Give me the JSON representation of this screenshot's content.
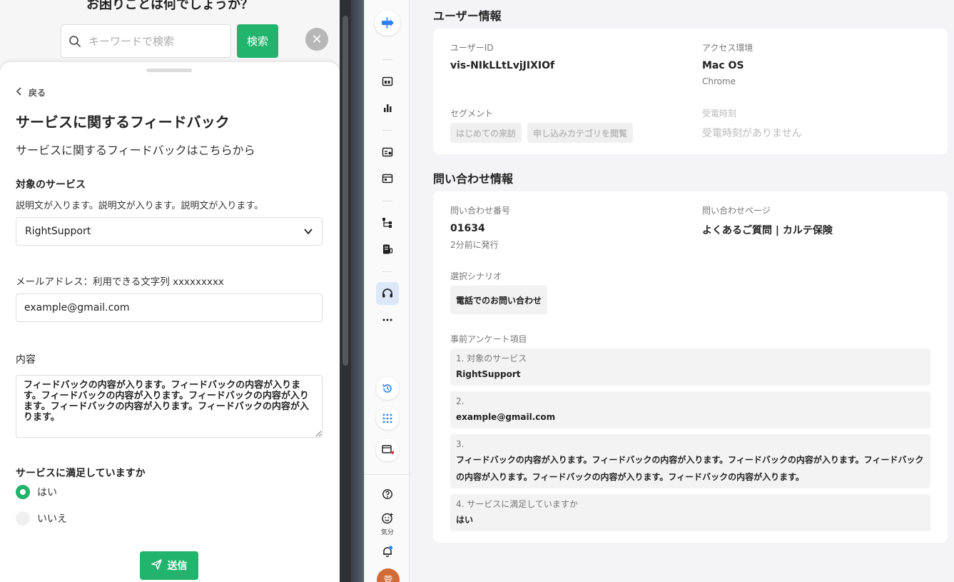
{
  "widget": {
    "help_heading": "お困りごとは何でしょうか？",
    "search": {
      "placeholder": "キーワードで検索",
      "value": "",
      "button_label": "検索"
    },
    "close_label": "✕",
    "back_label": "戻る",
    "title": "サービスに関するフィードバック",
    "subtitle": "サービスに関するフィードバックはこちらから",
    "service_field": {
      "label": "対象のサービス",
      "description": "説明文が入ります。説明文が入ります。説明文が入ります。",
      "selected": "RightSupport"
    },
    "email_field": {
      "label": "メールアドレス：利用できる文字列 xxxxxxxxx",
      "value": "example@gmail.com"
    },
    "content_field": {
      "label": "内容",
      "value": "フィードバックの内容が入ります。フィードバックの内容が入ります。フィードバックの内容が入ります。フィードバックの内容が入ります。フィードバックの内容が入ります。フィードバックの内容が入ります。"
    },
    "satisfaction_field": {
      "label": "サービスに満足していますか",
      "options": [
        "はい",
        "いいえ"
      ],
      "selected": "はい"
    },
    "submit_label": "送信"
  },
  "rail": {
    "mood_label": "気分",
    "avatar_text": "菅",
    "accent_color": "#2f80ed"
  },
  "user_info": {
    "section_title": "ユーザー情報",
    "user_id_label": "ユーザーID",
    "user_id": "vis-NIkLLtLvjJIXIOf",
    "access_label": "アクセス環境",
    "os": "Mac OS",
    "browser": "Chrome",
    "segment_label": "セグメント",
    "segments": [
      "はじめての来訪",
      "申し込みカテゴリを閲覧"
    ],
    "call_time_label": "受電時刻",
    "call_time_value": "受電時刻がありません"
  },
  "inquiry_info": {
    "section_title": "問い合わせ情報",
    "number_label": "問い合わせ番号",
    "number": "01634",
    "issued": "2分前に発行",
    "page_label": "問い合わせページ",
    "page": "よくあるご質問 | カルテ保険",
    "scenario_label": "選択シナリオ",
    "scenario": "電話でのお問い合わせ",
    "survey_label": "事前アンケート項目",
    "survey": [
      {
        "q": "1. 対象のサービス",
        "a": "RightSupport"
      },
      {
        "q": "2.",
        "a": "example@gmail.com"
      },
      {
        "q": "3.",
        "a": "フィードバックの内容が入ります。フィードバックの内容が入ります。フィードバックの内容が入ります。フィードバックの内容が入ります。フィードバックの内容が入ります。フィードバックの内容が入ります。"
      },
      {
        "q": "4. サービスに満足していますか",
        "a": "はい"
      }
    ]
  },
  "colors": {
    "green": "#22b36c",
    "accent_blue": "#2f80ed"
  }
}
